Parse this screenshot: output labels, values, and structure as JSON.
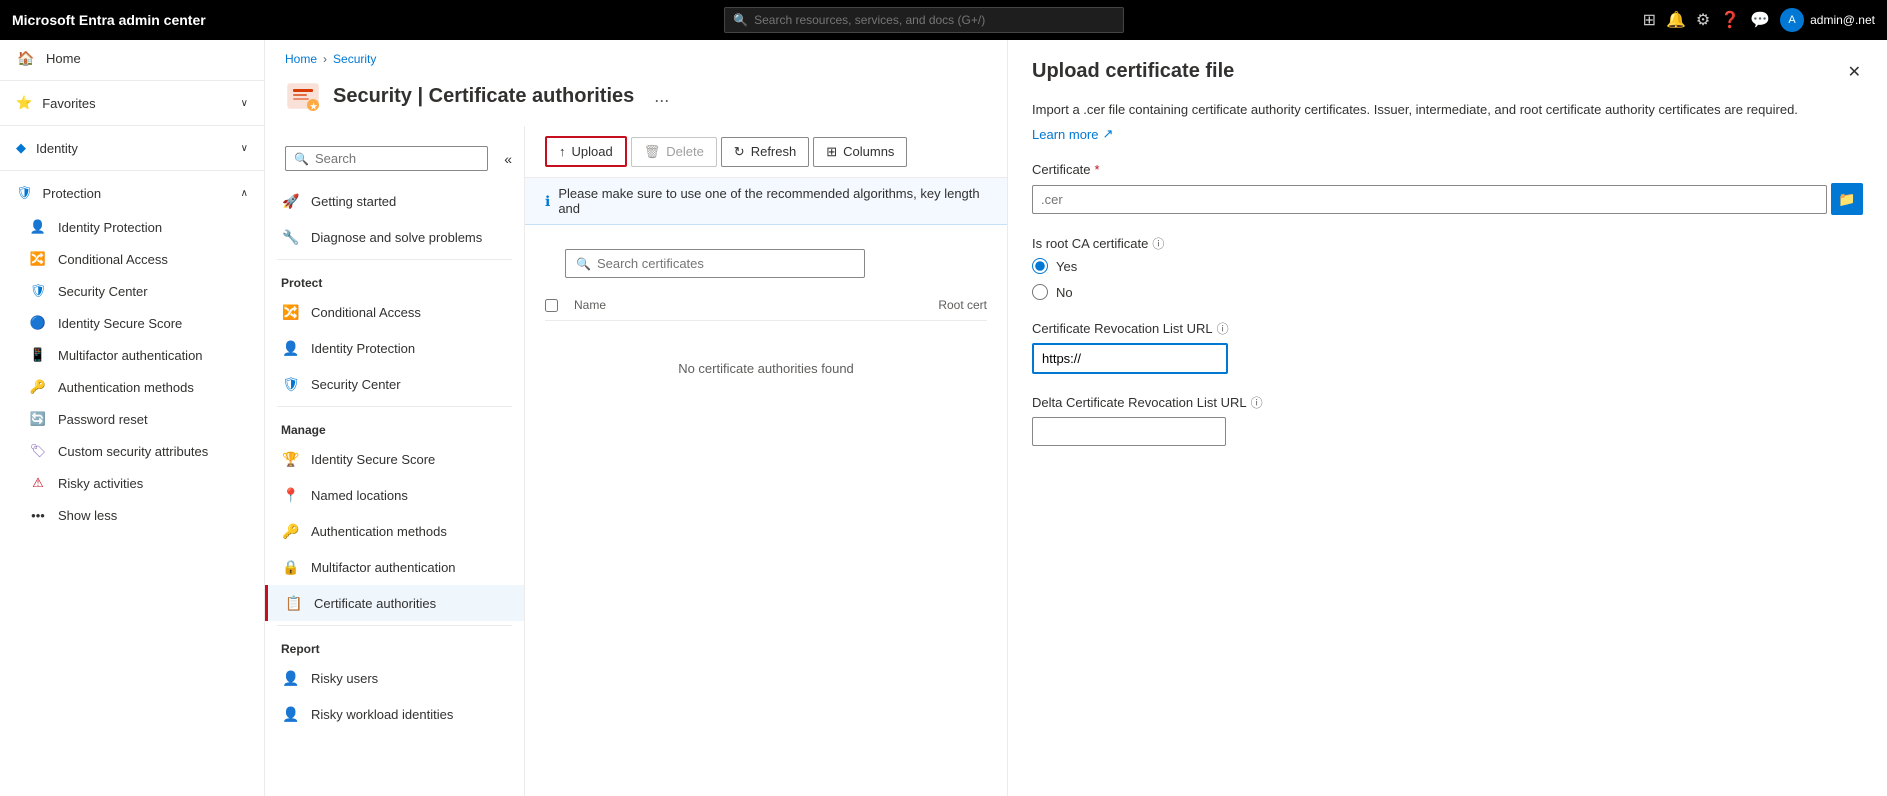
{
  "topbar": {
    "brand": "Microsoft Entra admin center",
    "search_placeholder": "Search resources, services, and docs (G+/)",
    "user": "admin@.net"
  },
  "sidebar": {
    "home_label": "Home",
    "favorites_label": "Favorites",
    "identity_label": "Identity",
    "protection_label": "Protection",
    "sub_items": {
      "identity_protection": "Identity Protection",
      "conditional_access": "Conditional Access",
      "security_center": "Security Center",
      "identity_secure_score": "Identity Secure Score",
      "multifactor_authentication": "Multifactor authentication",
      "authentication_methods": "Authentication methods",
      "password_reset": "Password reset",
      "custom_security": "Custom security attributes",
      "risky_activities": "Risky activities",
      "show_less": "Show less"
    }
  },
  "breadcrumb": {
    "home": "Home",
    "security": "Security"
  },
  "page": {
    "title": "Security | Certificate authorities",
    "more_label": "..."
  },
  "left_nav": {
    "search_placeholder": "Search",
    "section_protect": "Protect",
    "items_protect": [
      {
        "label": "Getting started",
        "icon": "🚀"
      },
      {
        "label": "Diagnose and solve problems",
        "icon": "🔧"
      }
    ],
    "conditional_access": "Conditional Access",
    "identity_protection": "Identity Protection",
    "security_center": "Security Center",
    "section_manage": "Manage",
    "items_manage": [
      {
        "label": "Identity Secure Score",
        "icon": "🏆"
      },
      {
        "label": "Named locations",
        "icon": "📍"
      },
      {
        "label": "Authentication methods",
        "icon": "🔑"
      },
      {
        "label": "Multifactor authentication",
        "icon": "🔒"
      },
      {
        "label": "Certificate authorities",
        "icon": "📋",
        "active": true
      }
    ],
    "section_report": "Report",
    "items_report": [
      {
        "label": "Risky users",
        "icon": "👤"
      },
      {
        "label": "Risky workload identities",
        "icon": "👤"
      }
    ]
  },
  "toolbar": {
    "upload_label": "Upload",
    "delete_label": "Delete",
    "refresh_label": "Refresh",
    "columns_label": "Columns"
  },
  "info_bar": {
    "message": "Please make sure to use one of the recommended algorithms, key length and"
  },
  "cert_search": {
    "placeholder": "Search certificates"
  },
  "table": {
    "col_name": "Name",
    "col_root_cert": "Root cert",
    "no_data": "No certificate authorities found"
  },
  "right_panel": {
    "title": "Upload certificate file",
    "description": "Import a .cer file containing certificate authority certificates. Issuer, intermediate, and root certificate authority certificates are required.",
    "learn_more": "Learn more",
    "cert_label": "Certificate",
    "cert_required": "*",
    "cert_placeholder": ".cer",
    "is_root_label": "Is root CA certificate",
    "radio_yes": "Yes",
    "radio_no": "No",
    "crl_url_label": "Certificate Revocation List URL",
    "crl_url_placeholder": "https://",
    "delta_crl_label": "Delta Certificate Revocation List URL",
    "delta_crl_placeholder": ""
  }
}
